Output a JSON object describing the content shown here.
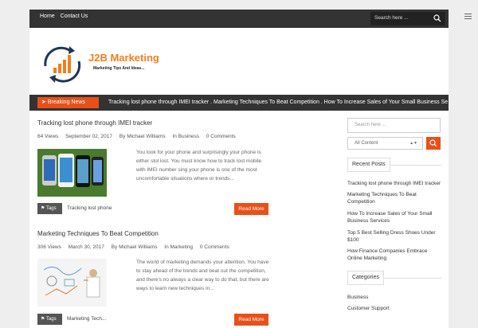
{
  "topnav": {
    "home": "Home",
    "contact": "Contact Us"
  },
  "search_top": {
    "placeholder": "Search here ...",
    "icon": "search-icon"
  },
  "logo": {
    "title": "J2B Marketing",
    "tagline": "Marketing Tips And Ideas..."
  },
  "breaking": {
    "label": "Breaking News",
    "ticker": "Tracking lost phone through IMEI tracker . Marketing Techniques To Beat Competition . How To Increase Sales of Your Small Business Se"
  },
  "posts": [
    {
      "title": "Tracking lost phone through IMEI tracker",
      "views": "64 Views",
      "date": "September 02, 2017",
      "author": "By Michael Williams",
      "category": "In Business",
      "comments": "0 Comments",
      "excerpt": "You look for your phone and surprisingly your phone is either stol lost. You must know how to track lost mobile with IMEI number sing your phone is one of the most uncomfortable situations where or trends...",
      "tag_label": "Tags",
      "tag": "Tracking lost phone",
      "read_more": "Read More"
    },
    {
      "title": "Marketing Techniques To Beat Competition",
      "views": "306 Views",
      "date": "March 30, 2017",
      "author": "By Michael Williams",
      "category": "In Marketing",
      "comments": "0 Comments",
      "excerpt": "The world of marketing demands your attention. You have to stay ahead of the trends and beat out the competition, and there's no always a clear way to do that, but there are ways to learn new techniques in...",
      "tag_label": "Tags",
      "tag": "Marketing Tech...",
      "read_more": "Read More"
    }
  ],
  "sidebar": {
    "search_placeholder": "Search here ...",
    "select_value": "All Content",
    "recent_title": "Recent Posts",
    "recent": [
      "Tracking lost phone through IMEI tracker",
      "Marketing Techniques To Beat Competition",
      "How To Increase Sales of Your Small Business Services",
      "Top 5 Best Selling Dress Shoes Under $100",
      "How Finance Companies Embrace Online Marketing"
    ],
    "categories_title": "Categories",
    "categories": [
      "Business",
      "Customer Support"
    ]
  },
  "colors": {
    "accent": "#e8501a",
    "bar": "#333333",
    "logo_orange": "#f07f1e"
  }
}
